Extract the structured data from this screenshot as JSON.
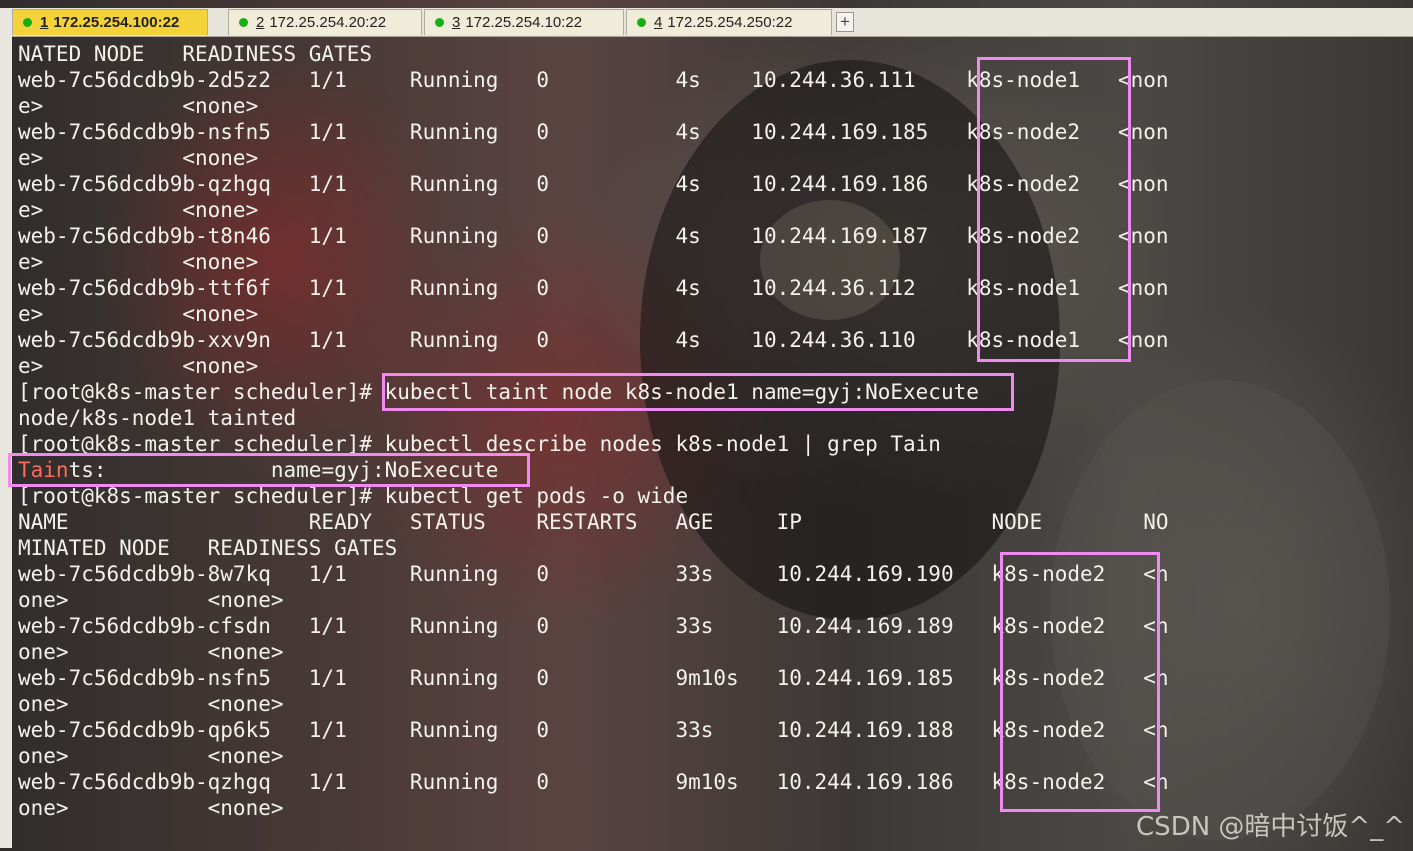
{
  "tabs": [
    {
      "number": "1",
      "host": "172.25.254.100:22",
      "active": true
    },
    {
      "number": "2",
      "host": "172.25.254.20:22",
      "active": false
    },
    {
      "number": "3",
      "host": "172.25.254.10:22",
      "active": false
    },
    {
      "number": "4",
      "host": "172.25.254.250:22",
      "active": false
    }
  ],
  "new_tab_label": "+",
  "terminal": {
    "lines": [
      "NATED NODE   READINESS GATES",
      "web-7c56dcdb9b-2d5z2   1/1     Running   0          4s    10.244.36.111    k8s-node1   <non",
      "e>           <none>",
      "web-7c56dcdb9b-nsfn5   1/1     Running   0          4s    10.244.169.185   k8s-node2   <non",
      "e>           <none>",
      "web-7c56dcdb9b-qzhgq   1/1     Running   0          4s    10.244.169.186   k8s-node2   <non",
      "e>           <none>",
      "web-7c56dcdb9b-t8n46   1/1     Running   0          4s    10.244.169.187   k8s-node2   <non",
      "e>           <none>",
      "web-7c56dcdb9b-ttf6f   1/1     Running   0          4s    10.244.36.112    k8s-node1   <non",
      "e>           <none>",
      "web-7c56dcdb9b-xxv9n   1/1     Running   0          4s    10.244.36.110    k8s-node1   <non",
      "e>           <none>",
      "[root@k8s-master scheduler]# kubectl taint node k8s-node1 name=gyj:NoExecute",
      "node/k8s-node1 tainted",
      "[root@k8s-master scheduler]# kubectl describe nodes k8s-node1 | grep Tain",
      "Taints:             name=gyj:NoExecute",
      "[root@k8s-master scheduler]# kubectl get pods -o wide",
      "NAME                   READY   STATUS    RESTARTS   AGE     IP               NODE        NO",
      "MINATED NODE   READINESS GATES",
      "web-7c56dcdb9b-8w7kq   1/1     Running   0          33s     10.244.169.190   k8s-node2   <n",
      "one>           <none>",
      "web-7c56dcdb9b-cfsdn   1/1     Running   0          33s     10.244.169.189   k8s-node2   <n",
      "one>           <none>",
      "web-7c56dcdb9b-nsfn5   1/1     Running   0          9m10s   10.244.169.185   k8s-node2   <n",
      "one>           <none>",
      "web-7c56dcdb9b-qp6k5   1/1     Running   0          33s     10.244.169.188   k8s-node2   <n",
      "one>           <none>",
      "web-7c56dcdb9b-qzhgq   1/1     Running   0          9m10s   10.244.169.186   k8s-node2   <n",
      "one>           <none>"
    ],
    "taints_highlight": "Tain",
    "taints_rest": "ts:             name=gyj:NoExecute"
  },
  "watermark": "CSDN @暗中讨饭^_^",
  "colors": {
    "highlight_box": "#f08af0",
    "grep_match": "#ff6a5a",
    "active_tab": "#f3d23a",
    "status_dot": "#15b015"
  }
}
